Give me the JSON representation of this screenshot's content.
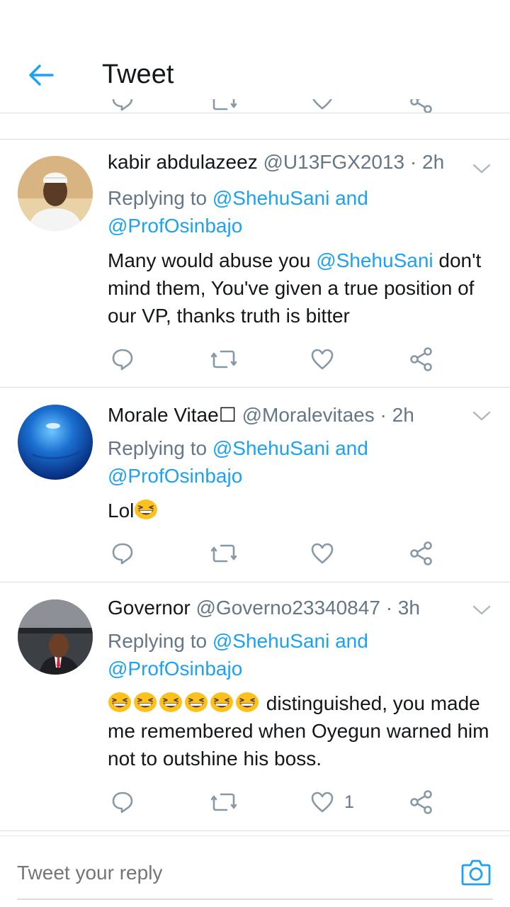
{
  "header": {
    "title": "Tweet",
    "back_icon": "arrow-left-icon",
    "accent_color": "#1da1f2"
  },
  "tweets": [
    {
      "name": "kabir abdulazeez",
      "handle": "@U13FGX2013",
      "separator": "·",
      "time": "2h",
      "replying_prefix": "Replying to ",
      "replying_link": "@ShehuSani and",
      "replying_link2": "@ProfOsinbajo",
      "body_parts": [
        "Many would abuse you ",
        "@ShehuSani",
        " don't mind them, You've given a true position of our VP, thanks truth is bitter"
      ],
      "like_count": ""
    },
    {
      "name": "Morale Vitae",
      "name_suffix": "☐",
      "handle": "@Moralevitaes",
      "separator": "·",
      "time": "2h",
      "replying_prefix": "Replying to ",
      "replying_link": "@ShehuSani and",
      "replying_link2": "@ProfOsinbajo",
      "body_text": "Lol",
      "like_count": ""
    },
    {
      "name": "Governor",
      "handle": "@Governo23340847",
      "separator": "·",
      "time": "3h",
      "replying_prefix": "Replying to ",
      "replying_link": "@ShehuSani and",
      "replying_link2": "@ProfOsinbajo",
      "body_text": " distinguished, you made me remembered when Oyegun warned him not to outshine his boss.",
      "like_count": "1"
    }
  ],
  "reply_box": {
    "placeholder": "Tweet your reply",
    "camera_icon": "camera-icon"
  },
  "icons": {
    "reply": "reply-icon",
    "retweet": "retweet-icon",
    "like": "heart-icon",
    "share": "share-icon",
    "menu": "chevron-down-icon",
    "emoji": "grinning-squinting-face-emoji"
  }
}
